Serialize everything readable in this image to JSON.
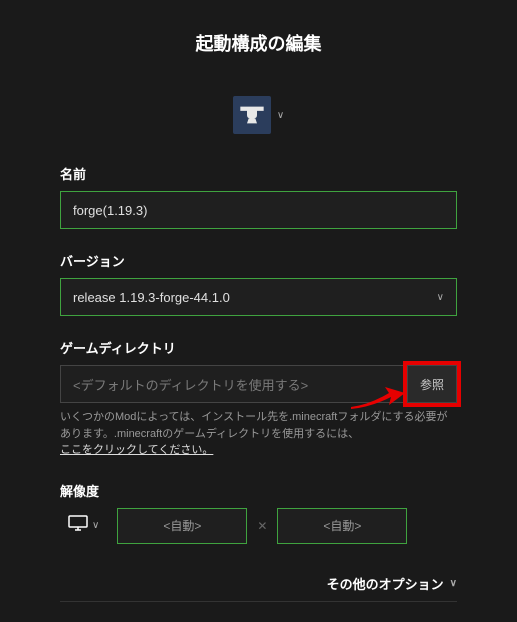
{
  "header": {
    "title": "起動構成の編集"
  },
  "fields": {
    "name": {
      "label": "名前",
      "value": "forge(1.19.3)"
    },
    "version": {
      "label": "バージョン",
      "value": "release 1.19.3-forge-44.1.0"
    },
    "gameDir": {
      "label": "ゲームディレクトリ",
      "placeholder": "<デフォルトのディレクトリを使用する>",
      "browse": "参照",
      "help1": "いくつかのModによっては、インストール先を.minecraftフォルダにする必要があります。.minecraftのゲームディレクトリを使用するには、",
      "helpLink": "ここをクリックしてください。"
    },
    "resolution": {
      "label": "解像度",
      "width": "<自動>",
      "height": "<自動>"
    }
  },
  "footer": {
    "moreOptions": "その他のオプション"
  }
}
